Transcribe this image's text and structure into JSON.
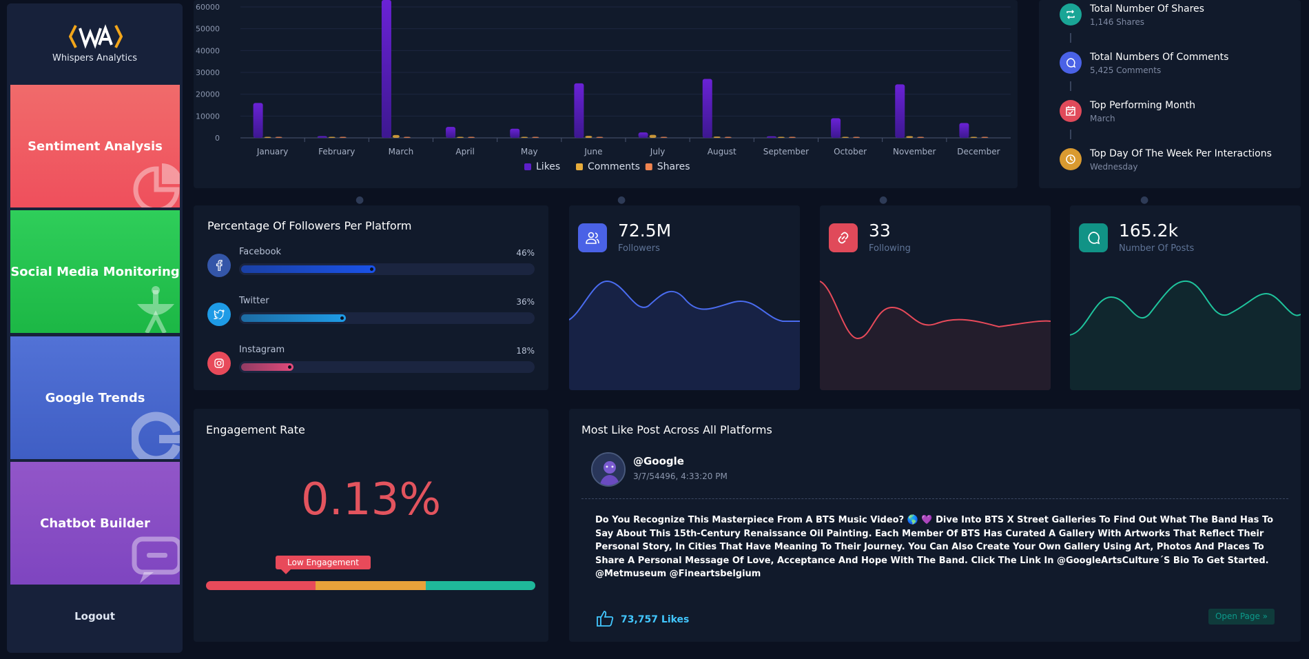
{
  "app": {
    "brand_name": "Whispers Analytics",
    "logo_mark": "WA"
  },
  "sidebar": {
    "items": [
      {
        "label": "Sentiment Analysis",
        "icon": "pie-chart-icon",
        "color": "#ef5a62"
      },
      {
        "label": "Social Media Monitoring",
        "icon": "satellite-dish-icon",
        "color": "#22c551"
      },
      {
        "label": "Google Trends",
        "icon": "google-icon",
        "color": "#4e6ed0"
      },
      {
        "label": "Chatbot Builder",
        "icon": "chat-bubble-icon",
        "color": "#8c4fc5"
      }
    ],
    "logout_label": "Logout"
  },
  "chart_data": {
    "type": "bar",
    "categories": [
      "January",
      "February",
      "March",
      "April",
      "May",
      "June",
      "July",
      "August",
      "September",
      "October",
      "November",
      "December"
    ],
    "ylim": [
      0,
      60000
    ],
    "y_ticks": [
      "0",
      "10000",
      "20000",
      "30000",
      "40000",
      "50000",
      "60000"
    ],
    "grid": true,
    "legend_position": "bottom",
    "series": [
      {
        "name": "Likes",
        "color": "#5d1fc9",
        "values": [
          16000,
          800,
          64000,
          5000,
          4200,
          25000,
          2500,
          27000,
          700,
          9000,
          24500,
          6800
        ]
      },
      {
        "name": "Comments",
        "color": "#e7ac3b",
        "values": [
          400,
          150,
          1300,
          250,
          200,
          900,
          1400,
          600,
          150,
          300,
          800,
          350
        ]
      },
      {
        "name": "Shares",
        "color": "#f08450",
        "values": [
          200,
          80,
          250,
          100,
          90,
          180,
          120,
          200,
          60,
          100,
          150,
          110
        ]
      }
    ]
  },
  "summary": {
    "items": [
      {
        "title": "Total Number Of Shares",
        "sub": "1,146 Shares",
        "icon": "repeat-icon",
        "color": "#1aa596"
      },
      {
        "title": "Total Numbers Of Comments",
        "sub": "5,425 Comments",
        "icon": "comment-icon",
        "color": "#4a62e6"
      },
      {
        "title": "Top Performing Month",
        "sub": "March",
        "icon": "calendar-icon",
        "color": "#e04a5a"
      },
      {
        "title": "Top Day Of The Week Per Interactions",
        "sub": "Wednesday",
        "icon": "clock-icon",
        "color": "#d99a30"
      }
    ]
  },
  "followers": {
    "title": "Percentage Of Followers Per Platform",
    "platforms": [
      {
        "name": "Facebook",
        "percent_label": "46%",
        "fraction": 0.46,
        "icon": "facebook-icon",
        "color": "#1a52e8",
        "icon_bg": "#3456a8"
      },
      {
        "name": "Twitter",
        "percent_label": "36%",
        "fraction": 0.36,
        "icon": "twitter-icon",
        "color": "#1e9be6",
        "icon_bg": "#1e9be6"
      },
      {
        "name": "Instagram",
        "percent_label": "18%",
        "fraction": 0.18,
        "icon": "instagram-icon",
        "color": "#e04a7a",
        "icon_bg": "#e84a5a"
      }
    ]
  },
  "kpis": [
    {
      "value": "72.5M",
      "label": "Followers",
      "icon": "users-icon",
      "color": "#4a62e6"
    },
    {
      "value": "33",
      "label": "Following",
      "icon": "link-icon",
      "color": "#e04a5a"
    },
    {
      "value": "165.2k",
      "label": "Number Of Posts",
      "icon": "message-icon",
      "color": "#119386"
    }
  ],
  "engagement": {
    "title": "Engagement Rate",
    "value": "0.13%",
    "badge": "Low Engagement",
    "segment_colors": [
      "#e84a5a",
      "#e8a23a",
      "#1fb89a"
    ]
  },
  "top_post": {
    "title": "Most Like Post Across All Platforms",
    "user": "@Google",
    "date": "3/7/54496, 4:33:20 PM",
    "text": "Do You Recognize This Masterpiece From A BTS Music Video? 🌎 💜 Dive Into BTS X Street Galleries To Find Out What The Band Has To Say About This 15th-Century Renaissance Oil Painting. Each Member Of BTS Has Curated A Gallery With Artworks That Reflect Their Personal Story, In Cities That Have Meaning To Their Journey. You Can Also Create Your Own Gallery Using Art, Photos And Places To Share A Personal Message Of Love, Acceptance And Hope With The Band. Click The Link In @GoogleArtsCulture´S Bio To Get Started. @Metmuseum @Fineartsbelgium",
    "likes": "73,757 Likes",
    "open_label": "Open Page »"
  }
}
